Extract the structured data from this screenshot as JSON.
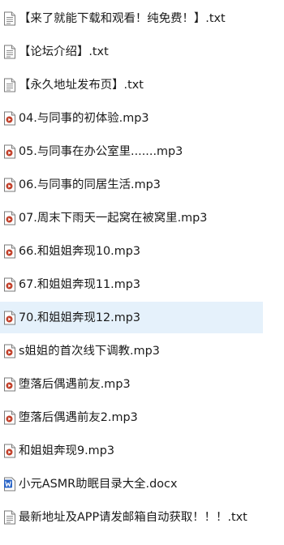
{
  "files": [
    {
      "name": "【来了就能下载和观看！纯免费！】.txt",
      "icon": "text-file-icon",
      "selected": false
    },
    {
      "name": "【论坛介绍】.txt",
      "icon": "text-file-icon",
      "selected": false
    },
    {
      "name": "【永久地址发布页】.txt",
      "icon": "text-file-icon",
      "selected": false
    },
    {
      "name": "04.与同事的初体验.mp3",
      "icon": "audio-file-icon",
      "selected": false
    },
    {
      "name": "05.与同事在办公室里.......mp3",
      "icon": "audio-file-icon",
      "selected": false
    },
    {
      "name": "06.与同事的同居生活.mp3",
      "icon": "audio-file-icon",
      "selected": false
    },
    {
      "name": "07.周末下雨天一起窝在被窝里.mp3",
      "icon": "audio-file-icon",
      "selected": false
    },
    {
      "name": "66.和姐姐奔现10.mp3",
      "icon": "audio-file-icon",
      "selected": false
    },
    {
      "name": "67.和姐姐奔现11.mp3",
      "icon": "audio-file-icon",
      "selected": false
    },
    {
      "name": "70.和姐姐奔现12.mp3",
      "icon": "audio-file-icon",
      "selected": true
    },
    {
      "name": "s姐姐的首次线下调教.mp3",
      "icon": "audio-file-icon",
      "selected": false
    },
    {
      "name": "堕落后偶遇前友.mp3",
      "icon": "audio-file-icon",
      "selected": false
    },
    {
      "name": "堕落后偶遇前友2.mp3",
      "icon": "audio-file-icon",
      "selected": false
    },
    {
      "name": "和姐姐奔现9.mp3",
      "icon": "audio-file-icon",
      "selected": false
    },
    {
      "name": "小元ASMR助眠目录大全.docx",
      "icon": "word-document-icon",
      "selected": false
    },
    {
      "name": "最新地址及APP请发邮箱自动获取！！！.txt",
      "icon": "text-file-icon",
      "selected": false
    }
  ],
  "colors": {
    "selection": "#e5f1fb",
    "text": "#1a1a1a",
    "audio_accent": "#c2402a",
    "word_blue": "#2b65c7"
  }
}
